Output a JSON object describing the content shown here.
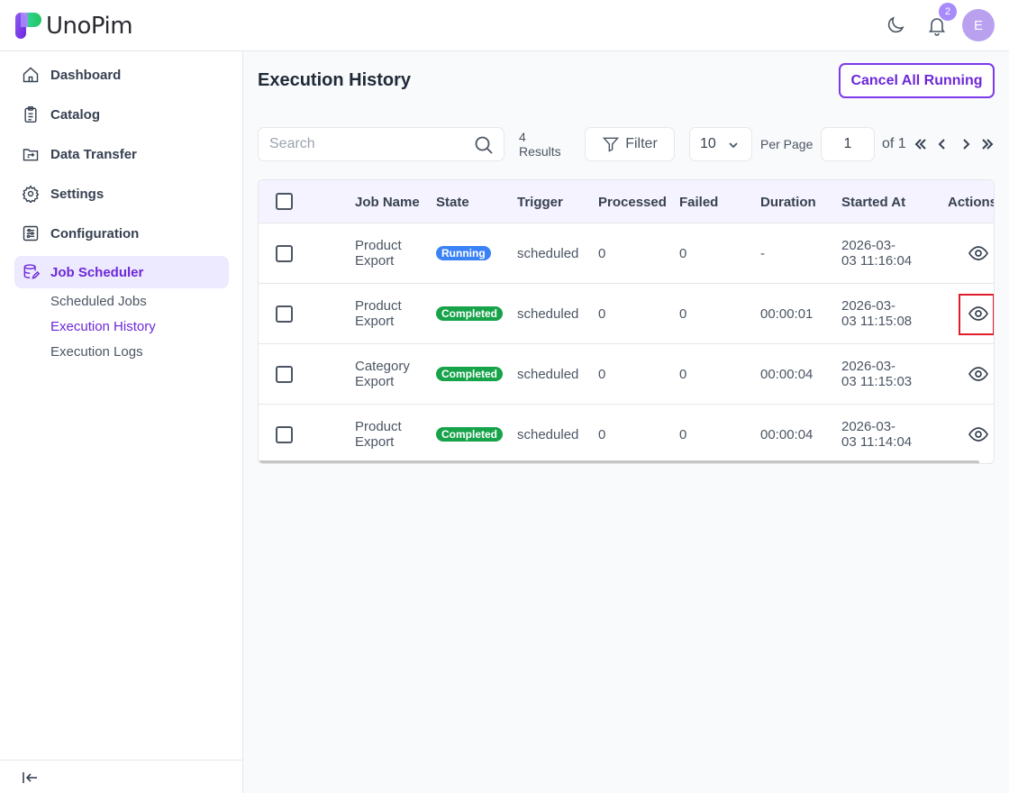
{
  "app": {
    "name": "UnoPim"
  },
  "header": {
    "notification_count": "2",
    "avatar_initial": "E"
  },
  "sidebar": {
    "items": [
      {
        "label": "Dashboard",
        "icon": "home-icon"
      },
      {
        "label": "Catalog",
        "icon": "clipboard-list-icon"
      },
      {
        "label": "Data Transfer",
        "icon": "folder-transfer-icon"
      },
      {
        "label": "Settings",
        "icon": "gear-icon"
      },
      {
        "label": "Configuration",
        "icon": "sliders-icon"
      },
      {
        "label": "Job Scheduler",
        "icon": "scheduler-icon",
        "active": true
      }
    ],
    "subitems": [
      {
        "label": "Scheduled Jobs"
      },
      {
        "label": "Execution History",
        "active": true
      },
      {
        "label": "Execution Logs"
      }
    ]
  },
  "main": {
    "title": "Execution History",
    "cancel_all_label": "Cancel All Running",
    "toolbar": {
      "search_placeholder": "Search",
      "results_count": "4",
      "results_label": "Results",
      "filter_label": "Filter",
      "per_page_value": "10",
      "per_page_label": "Per Page",
      "current_page": "1",
      "of_pages": "of 1"
    },
    "table": {
      "columns": [
        "Job Name",
        "State",
        "Trigger",
        "Processed",
        "Failed",
        "Duration",
        "Started At",
        "Actions"
      ],
      "rows": [
        {
          "job_line1": "Product",
          "job_line2": "Export",
          "state": "Running",
          "trigger": "scheduled",
          "processed": "0",
          "failed": "0",
          "duration": "-",
          "started_line1": "2026-03-",
          "started_line2": "03 11:16:04"
        },
        {
          "job_line1": "Product",
          "job_line2": "Export",
          "state": "Completed",
          "trigger": "scheduled",
          "processed": "0",
          "failed": "0",
          "duration": "00:00:01",
          "started_line1": "2026-03-",
          "started_line2": "03 11:15:08"
        },
        {
          "job_line1": "Category",
          "job_line2": "Export",
          "state": "Completed",
          "trigger": "scheduled",
          "processed": "0",
          "failed": "0",
          "duration": "00:00:04",
          "started_line1": "2026-03-",
          "started_line2": "03 11:15:03"
        },
        {
          "job_line1": "Product",
          "job_line2": "Export",
          "state": "Completed",
          "trigger": "scheduled",
          "processed": "0",
          "failed": "0",
          "duration": "00:00:04",
          "started_line1": "2026-03-",
          "started_line2": "03 11:14:04"
        }
      ]
    }
  },
  "colors": {
    "accent": "#6d28d9",
    "running": "#3b82f6",
    "completed": "#16a34a",
    "highlight": "#e11d2c"
  }
}
